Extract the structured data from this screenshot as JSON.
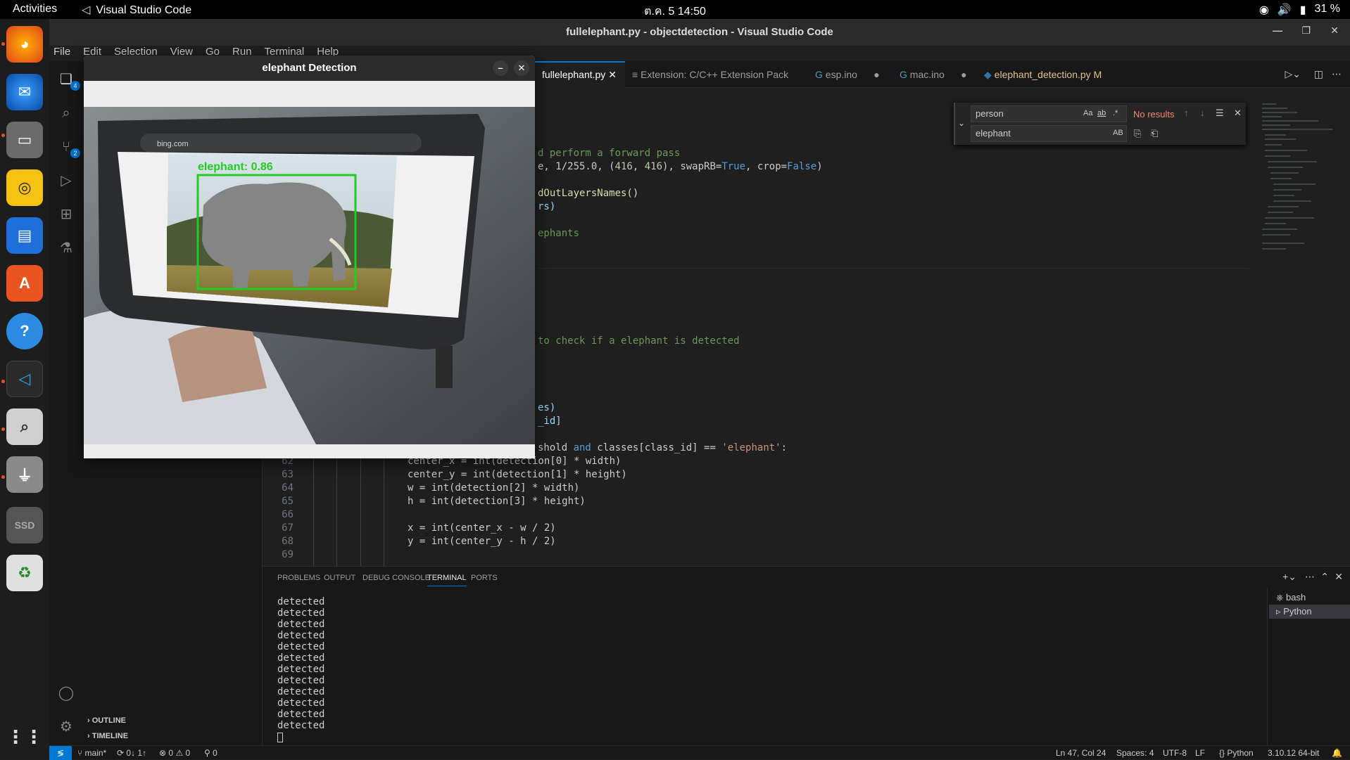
{
  "topbar": {
    "activities": "Activities",
    "app": "Visual Studio Code",
    "clock": "ต.ค. 5  14:50",
    "battery": "31 %"
  },
  "window": {
    "title": "fullelephant.py - objectdetection - Visual Studio Code"
  },
  "menu": [
    "File",
    "Edit",
    "Selection",
    "View",
    "Go",
    "Run",
    "Terminal",
    "Help"
  ],
  "activity_badges": {
    "explorer": "4",
    "scm": "2"
  },
  "sidebar": {
    "outline": "OUTLINE",
    "timeline": "TIMELINE"
  },
  "tabs": [
    {
      "label": "fullelephant.py"
    },
    {
      "label": "Extension: C/C++ Extension Pack"
    },
    {
      "label": "esp.ino"
    },
    {
      "label": "mac.ino"
    },
    {
      "label": "elephant_detection.py",
      "mod": "M"
    }
  ],
  "find": {
    "search": "person",
    "replace": "elephant",
    "result": "No results",
    "opt_case": "Aa",
    "opt_word": "ab",
    "opt_regex": ".*",
    "opt_preserve": "AB"
  },
  "code_fragments": {
    "l1": "d perform a forward pass",
    "l2a": "e, 1/255.0, (",
    "l2b": "416",
    "l2c": ", ",
    "l2d": "416",
    "l2e": "), swapRB=",
    "l2f": "True",
    "l2g": ", crop=",
    "l2h": "False",
    "l2i": ")",
    "l3": "dOutLayersNames()",
    "l4": "rs)",
    "l5": "ephants",
    "l6": "to check if a elephant is detected",
    "l7": "es)",
    "l8": "_id]",
    "l9a": "shold ",
    "l9b": "and",
    "l9c": " classes[class_id] == ",
    "l9d": "'elephant'",
    "l9e": ":"
  },
  "code_lines": [
    {
      "n": "62",
      "code": "center_x = int(detection[0] * width)"
    },
    {
      "n": "63",
      "code": "center_y = int(detection[1] * height)"
    },
    {
      "n": "64",
      "code": "w = int(detection[2] * width)"
    },
    {
      "n": "65",
      "code": "h = int(detection[3] * height)"
    },
    {
      "n": "66",
      "code": ""
    },
    {
      "n": "67",
      "code": "x = int(center_x - w / 2)"
    },
    {
      "n": "68",
      "code": "y = int(center_y - h / 2)"
    },
    {
      "n": "69",
      "code": ""
    }
  ],
  "panel": {
    "tabs": [
      "PROBLEMS",
      "OUTPUT",
      "DEBUG CONSOLE",
      "TERMINAL",
      "PORTS"
    ],
    "terminal_lines": [
      "detected",
      "detected",
      "detected",
      "detected",
      "detected",
      "detected",
      "detected",
      "detected",
      "detected",
      "detected",
      "detected",
      "detected"
    ],
    "terminals": [
      "bash",
      "Python"
    ]
  },
  "status": {
    "branch": "main*",
    "sync": "0↓ 1↑",
    "errors": "0",
    "warnings": "0",
    "ports": "0",
    "position": "Ln 47, Col 24",
    "spaces": "Spaces: 4",
    "encoding": "UTF-8",
    "eol": "LF",
    "language": "Python",
    "interpreter": "3.10.12 64-bit"
  },
  "cv": {
    "title": "elephant Detection",
    "label": "elephant: 0.86",
    "url": "bing.com",
    "box_color": "#22cc22"
  }
}
